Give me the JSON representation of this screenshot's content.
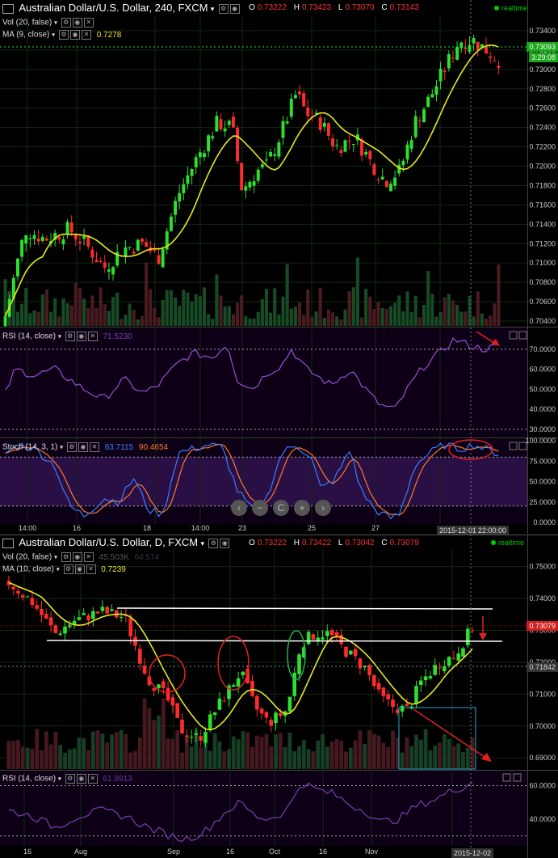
{
  "top": {
    "title": "Australian Dollar/U.S. Dollar, 240, FXCM",
    "ohlc": {
      "o": "0.73222",
      "h": "0.73423",
      "l": "0.73070",
      "c": "0.73143"
    },
    "vol_label": "Vol (20, false)",
    "ma_label": "MA (9, close)",
    "ma_value": "0.7278",
    "realtime": "realtime",
    "price_axis": [
      "0.73400",
      "0.73200",
      "0.73000",
      "0.72800",
      "0.72600",
      "0.72400",
      "0.72200",
      "0.72000",
      "0.71800",
      "0.71600",
      "0.71400",
      "0.71200",
      "0.71000",
      "0.70800",
      "0.70600",
      "0.70400"
    ],
    "last_price": "0.73093",
    "countdown": "3:29:08",
    "rsi_label": "RSI (14, close)",
    "rsi_value": "71.5230",
    "rsi_axis": [
      "70.0000",
      "60.0000",
      "50.0000",
      "40.0000",
      "30.0000"
    ],
    "stoch_label": "Stoch (14, 3, 1)",
    "stoch_k": "83.7115",
    "stoch_d": "90.4654",
    "stoch_axis": [
      "100.0000",
      "75.0000",
      "50.0000",
      "25.0000",
      "0.0000"
    ],
    "x_axis": [
      "14:00",
      "16",
      "18",
      "14:00",
      "23",
      "25",
      "27"
    ],
    "date_box": "2015-12-01",
    "time_box": "22:00:00",
    "nav_buttons": [
      "‹",
      "−",
      "C",
      "+",
      "›"
    ]
  },
  "bottom": {
    "title": "Australian Dollar/U.S. Dollar, D, FXCM",
    "ohlc": {
      "o": "0.73222",
      "h": "0.73422",
      "l": "0.73042",
      "c": "0.73079"
    },
    "vol_label": "Vol (20, false)",
    "vol_value": "45.503K",
    "vol_value2": "64.574",
    "ma_label": "MA (10, close)",
    "ma_value": "0.7239",
    "realtime": "realtime",
    "price_axis": [
      "0.75000",
      "0.74000",
      "0.73000",
      "0.72000",
      "0.71000",
      "0.70000",
      "0.69000"
    ],
    "last_price": "0.73079",
    "ref_price": "0.71842",
    "rsi_label": "RSI (14, close)",
    "rsi_value": "61.8913",
    "rsi_axis": [
      "60.0000",
      "40.0000"
    ],
    "x_axis": [
      "16",
      "Aug",
      "Sep",
      "16",
      "Oct",
      "16",
      "Nov"
    ],
    "date_box": "2015-12-02"
  },
  "colors": {
    "up": "#2ee02e",
    "down": "#ff2b2b",
    "ma": "#e8e81a",
    "rsi": "#9b4fd6",
    "stoch_k": "#3a7dff",
    "stoch_d": "#ff7a2a",
    "grid": "#1f3a1f",
    "annot": "#e02020",
    "resist": "#ffffff",
    "box": "#22aacc"
  }
}
